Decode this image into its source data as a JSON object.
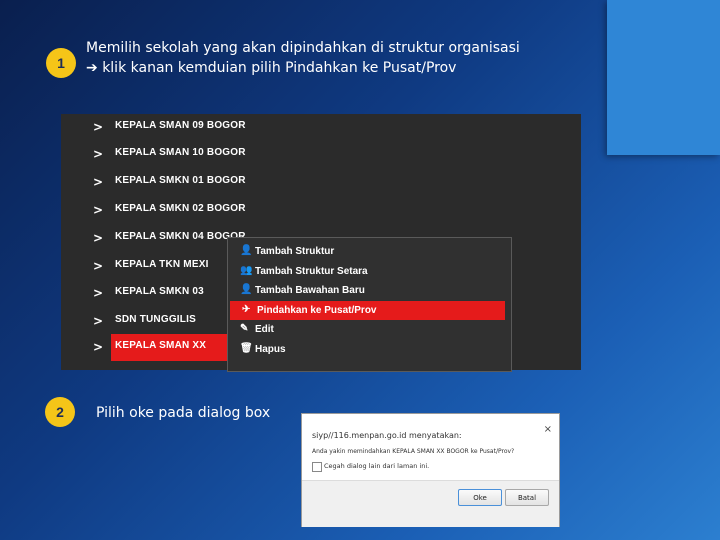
{
  "steps": [
    {
      "number": "1",
      "line1": "Memilih sekolah yang akan dipindahkan di struktur organisasi",
      "line2": "klik kanan kemduian pilih Pindahkan ke Pusat/Prov"
    },
    {
      "number": "2",
      "text": "Pilih oke pada dialog box"
    }
  ],
  "tree": {
    "items": [
      "KEPALA SMAN 09 BOGOR",
      "KEPALA SMAN 10 BOGOR",
      "KEPALA SMKN 01 BOGOR",
      "KEPALA SMKN 02 BOGOR",
      "KEPALA SMKN 04 BOGOR",
      "KEPALA TKN MEXI",
      "KEPALA SMKN 03",
      "SDN TUNGGILIS",
      "KEPALA SMAN XX"
    ],
    "selected_index": 8,
    "chevron": ">"
  },
  "context_menu": {
    "items": [
      {
        "label": "Tambah Struktur",
        "icon": "user-icon",
        "glyph": "👤"
      },
      {
        "label": "Tambah Struktur Setara",
        "icon": "users-icon",
        "glyph": "👥"
      },
      {
        "label": "Tambah Bawahan Baru",
        "icon": "user-plus-icon",
        "glyph": "👤"
      },
      {
        "label": "Pindahkan ke Pusat/Prov",
        "icon": "send-icon",
        "glyph": "✈"
      },
      {
        "label": "Edit",
        "icon": "pencil-icon",
        "glyph": "✎"
      },
      {
        "label": "Hapus",
        "icon": "trash-icon",
        "glyph": "🗑"
      }
    ],
    "selected_index": 3
  },
  "dialog": {
    "title": "siyp//116.menpan.go.id menyatakan:",
    "message": "Anda yakin memindahkan KEPALA SMAN XX BOGOR ke Pusat/Prov?",
    "checkbox_label": "Cegah dialog lain dari laman ini.",
    "close_glyph": "×",
    "ok_label": "Oke",
    "cancel_label": "Batal"
  },
  "colors": {
    "accent_red": "#e51b1b",
    "badge_yellow": "#f5c518",
    "menu_bg": "#2b2b2b"
  }
}
